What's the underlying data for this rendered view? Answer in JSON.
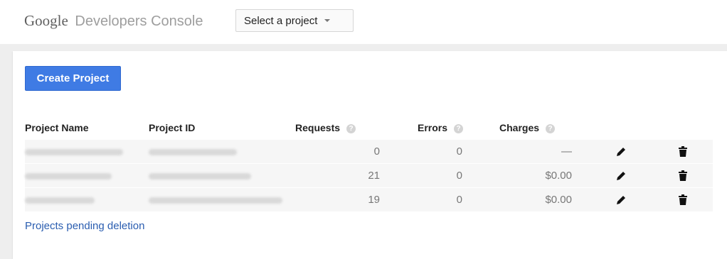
{
  "header": {
    "brand_google": "Google",
    "brand_product": "Developers Console",
    "project_select_label": "Select a project"
  },
  "main": {
    "create_button_label": "Create Project",
    "table": {
      "columns": {
        "name": "Project Name",
        "id": "Project ID",
        "requests": "Requests",
        "errors": "Errors",
        "charges": "Charges"
      },
      "help_glyph": "?",
      "rows": [
        {
          "name": "My GPlus Project",
          "id": "virtual-drum-726",
          "requests": "0",
          "errors": "0",
          "charges": "—"
        },
        {
          "name": "MyGoogleMaps",
          "id": "vl-stella-expresso-4",
          "requests": "21",
          "errors": "0",
          "charges": "$0.00"
        },
        {
          "name": "MyPlaceAPI",
          "id": "api-project-108495660573",
          "requests": "19",
          "errors": "0",
          "charges": "$0.00"
        }
      ]
    },
    "pending_link_label": "Projects pending deletion"
  },
  "icons": {
    "edit": "pencil-icon",
    "delete": "trash-icon",
    "help": "help-circle-icon"
  },
  "colors": {
    "primary_button": "#3f7be4",
    "link": "#2a5db0",
    "row_bg": "#f6f6f6",
    "shell_bg": "#eeeeee"
  }
}
